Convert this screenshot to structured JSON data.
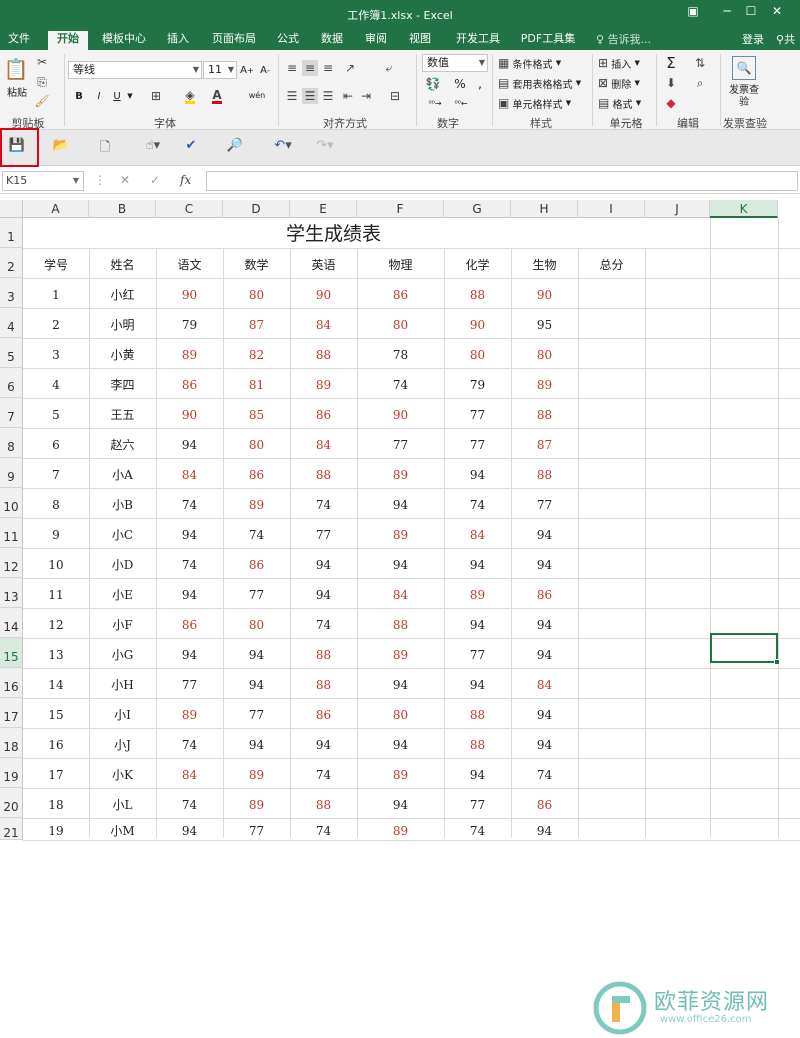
{
  "window": {
    "title": "工作簿1.xlsx - Excel"
  },
  "ribbon_tabs": [
    "文件",
    "开始",
    "模板中心",
    "插入",
    "页面布局",
    "公式",
    "数据",
    "审阅",
    "视图",
    "开发工具",
    "PDF工具集"
  ],
  "active_tab": "开始",
  "tell_me": "告诉我...",
  "login": "登录",
  "share": "共",
  "ribbon": {
    "paste": "粘贴",
    "clipboard_label": "剪贴板",
    "font_name": "等线",
    "font_size": "11",
    "font_label": "字体",
    "align_label": "对齐方式",
    "number_format": "数值",
    "number_label": "数字",
    "cond_format": "条件格式",
    "table_format": "套用表格格式",
    "cell_style": "单元格样式",
    "style_label": "样式",
    "insert": "插入",
    "delete": "删除",
    "format": "格式",
    "cells_label": "单元格",
    "edit_label": "编辑",
    "invoice_btn": "发票查验",
    "invoice_label": "发票查验",
    "wen": "wén",
    "bold": "B",
    "italic": "I",
    "underline": "U"
  },
  "name_box": "K15",
  "fx": "fx",
  "columns": [
    "A",
    "B",
    "C",
    "D",
    "E",
    "F",
    "G",
    "H",
    "I",
    "J",
    "K"
  ],
  "rows": [
    "1",
    "2",
    "3",
    "4",
    "5",
    "6",
    "7",
    "8",
    "9",
    "10",
    "11",
    "12",
    "13",
    "14",
    "15",
    "16",
    "17",
    "18",
    "19",
    "20",
    "21"
  ],
  "sheet_title": "学生成绩表",
  "headers": [
    "学号",
    "姓名",
    "语文",
    "数学",
    "英语",
    "物理",
    "化学",
    "生物",
    "总分"
  ],
  "students": [
    [
      "1",
      "小红",
      "90",
      "80",
      "90",
      "86",
      "88",
      "90"
    ],
    [
      "2",
      "小明",
      "79",
      "87",
      "84",
      "80",
      "90",
      "95"
    ],
    [
      "3",
      "小黄",
      "89",
      "82",
      "88",
      "78",
      "80",
      "80"
    ],
    [
      "4",
      "李四",
      "86",
      "81",
      "89",
      "74",
      "79",
      "89"
    ],
    [
      "5",
      "王五",
      "90",
      "85",
      "86",
      "90",
      "77",
      "88"
    ],
    [
      "6",
      "赵六",
      "94",
      "80",
      "84",
      "77",
      "77",
      "87"
    ],
    [
      "7",
      "小A",
      "84",
      "86",
      "88",
      "89",
      "94",
      "88"
    ],
    [
      "8",
      "小B",
      "74",
      "89",
      "74",
      "94",
      "74",
      "77"
    ],
    [
      "9",
      "小C",
      "94",
      "74",
      "77",
      "89",
      "84",
      "94"
    ],
    [
      "10",
      "小D",
      "74",
      "86",
      "94",
      "94",
      "94",
      "94"
    ],
    [
      "11",
      "小E",
      "94",
      "77",
      "94",
      "84",
      "89",
      "86"
    ],
    [
      "12",
      "小F",
      "86",
      "80",
      "74",
      "88",
      "94",
      "94"
    ],
    [
      "13",
      "小G",
      "94",
      "94",
      "88",
      "89",
      "77",
      "94"
    ],
    [
      "14",
      "小H",
      "77",
      "94",
      "88",
      "94",
      "94",
      "84"
    ],
    [
      "15",
      "小I",
      "89",
      "77",
      "86",
      "80",
      "88",
      "94"
    ],
    [
      "16",
      "小J",
      "74",
      "94",
      "94",
      "94",
      "88",
      "94"
    ],
    [
      "17",
      "小K",
      "84",
      "89",
      "74",
      "89",
      "94",
      "74"
    ],
    [
      "18",
      "小L",
      "74",
      "89",
      "88",
      "94",
      "77",
      "86"
    ],
    [
      "19",
      "小M",
      "94",
      "77",
      "74",
      "89",
      "74",
      "94"
    ]
  ],
  "score_colors": {
    "high": "#c0392b",
    "normal": "#222222",
    "threshold": "80-90"
  },
  "accent_color": "#217346",
  "watermark": {
    "main": "欧菲资源网",
    "sub": "www.office26.com"
  }
}
